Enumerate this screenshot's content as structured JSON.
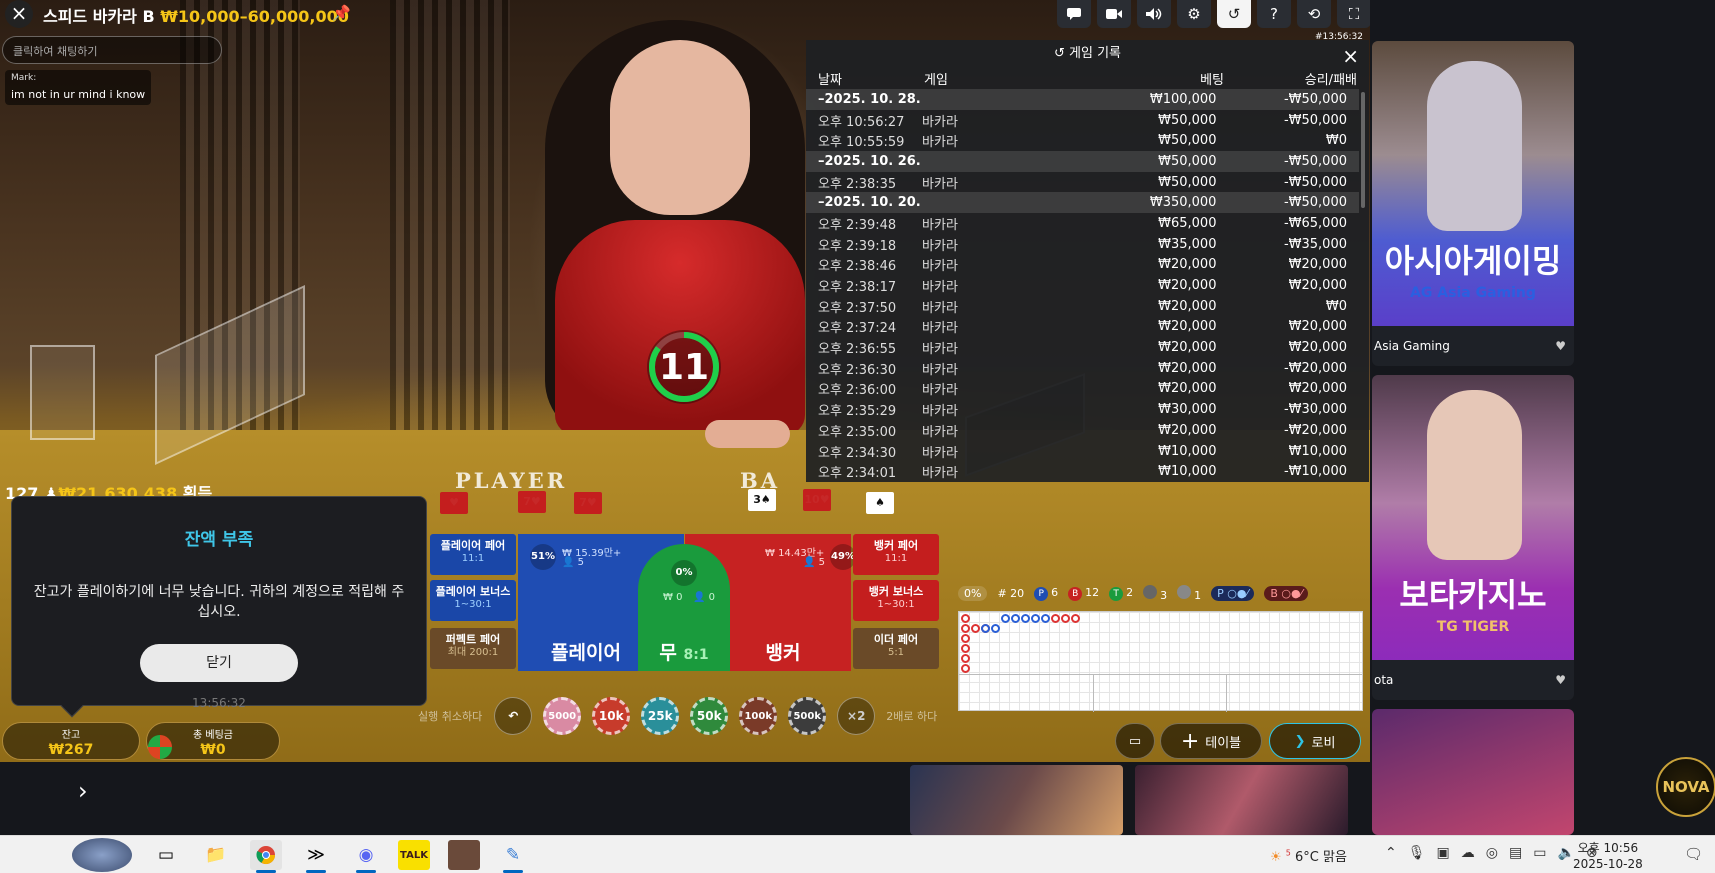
{
  "header": {
    "title": "스피드 바카라 B",
    "limit": "₩10,000–60,000,000",
    "chat_placeholder": "클릭하여 채팅하기",
    "chat_user": "Mark:",
    "chat_text": "im not in ur mind i know",
    "clock": "#13:56:32"
  },
  "toolbar": [
    "chat-icon",
    "video-icon",
    "volume-icon",
    "gear-icon",
    "history-icon",
    "help-icon",
    "refresh-icon",
    "fullscreen-icon"
  ],
  "timer": "11",
  "winnings": {
    "count": "127",
    "amount": "₩21,630,438",
    "label": "획득"
  },
  "felt": {
    "player": "PLAYER",
    "banker": "BA"
  },
  "history": {
    "title": "게임 기록",
    "columns": [
      "날짜",
      "게임",
      "베팅",
      "승리/패배"
    ],
    "rows": [
      {
        "date": "–2025. 10. 28.",
        "game": "",
        "bet": "₩100,000",
        "result": "-₩50,000",
        "sep": true
      },
      {
        "date": "오후 10:56:27",
        "game": "바카라",
        "bet": "₩50,000",
        "result": "-₩50,000"
      },
      {
        "date": "오후 10:55:59",
        "game": "바카라",
        "bet": "₩50,000",
        "result": "₩0"
      },
      {
        "date": "–2025. 10. 26.",
        "game": "",
        "bet": "₩50,000",
        "result": "-₩50,000",
        "sep": true
      },
      {
        "date": "오후 2:38:35",
        "game": "바카라",
        "bet": "₩50,000",
        "result": "-₩50,000"
      },
      {
        "date": "–2025. 10. 20.",
        "game": "",
        "bet": "₩350,000",
        "result": "-₩50,000",
        "sep": true
      },
      {
        "date": "오후 2:39:48",
        "game": "바카라",
        "bet": "₩65,000",
        "result": "-₩65,000"
      },
      {
        "date": "오후 2:39:18",
        "game": "바카라",
        "bet": "₩35,000",
        "result": "-₩35,000"
      },
      {
        "date": "오후 2:38:46",
        "game": "바카라",
        "bet": "₩20,000",
        "result": "₩20,000"
      },
      {
        "date": "오후 2:38:17",
        "game": "바카라",
        "bet": "₩20,000",
        "result": "₩20,000"
      },
      {
        "date": "오후 2:37:50",
        "game": "바카라",
        "bet": "₩20,000",
        "result": "₩0"
      },
      {
        "date": "오후 2:37:24",
        "game": "바카라",
        "bet": "₩20,000",
        "result": "₩20,000"
      },
      {
        "date": "오후 2:36:55",
        "game": "바카라",
        "bet": "₩20,000",
        "result": "₩20,000"
      },
      {
        "date": "오후 2:36:30",
        "game": "바카라",
        "bet": "₩20,000",
        "result": "-₩20,000"
      },
      {
        "date": "오후 2:36:00",
        "game": "바카라",
        "bet": "₩20,000",
        "result": "₩20,000"
      },
      {
        "date": "오후 2:35:29",
        "game": "바카라",
        "bet": "₩30,000",
        "result": "-₩30,000"
      },
      {
        "date": "오후 2:35:00",
        "game": "바카라",
        "bet": "₩20,000",
        "result": "-₩20,000"
      },
      {
        "date": "오후 2:34:30",
        "game": "바카라",
        "bet": "₩10,000",
        "result": "₩10,000"
      },
      {
        "date": "오후 2:34:01",
        "game": "바카라",
        "bet": "₩10,000",
        "result": "-₩10,000"
      }
    ]
  },
  "bets": {
    "player_pair": {
      "label": "플레이어 페어",
      "odds": "11:1"
    },
    "player_bonus": {
      "label": "플레이어 보너스",
      "odds": "1~30:1"
    },
    "perfect_pair": {
      "label": "퍼펙트 페어",
      "odds": "최대 200:1"
    },
    "banker_pair": {
      "label": "뱅커 페어",
      "odds": "11:1"
    },
    "banker_bonus": {
      "label": "뱅커 보너스",
      "odds": "1~30:1"
    },
    "either_pair": {
      "label": "이더 페어",
      "odds": "5:1"
    },
    "player": {
      "label": "플레이어",
      "pct": "51%",
      "amount": "₩ 15.39만+",
      "players": "5"
    },
    "tie": {
      "label": "무",
      "odds": "8:1",
      "pct": "0%",
      "amount": "₩ 0",
      "players": "0"
    },
    "banker": {
      "label": "뱅커",
      "pct": "49%",
      "amount": "₩ 14.43만+",
      "players": "5"
    }
  },
  "dialog": {
    "title": "잔액 부족",
    "body": "잔고가 플레이하기에 너무 낮습니다. 귀하의 계정으로 적립해 주십시오.",
    "button": "닫기",
    "time": "13:56:32"
  },
  "balance": {
    "label": "잔고",
    "value": "₩267"
  },
  "total_bet": {
    "label": "총 베팅금",
    "value": "₩0"
  },
  "chips": {
    "undo_label": "실행 취소하다",
    "values": [
      "5000",
      "10k",
      "25k",
      "50k",
      "100k",
      "500k"
    ],
    "double_symbol": "×2",
    "double_label": "2배로 하다"
  },
  "road_stats": {
    "pct": "0%",
    "rounds": "# 20",
    "p_label": "P",
    "p": "6",
    "b_label": "B",
    "b": "12",
    "t_label": "T",
    "t": "2",
    "pp": "3",
    "bp": "1"
  },
  "controls": {
    "table": "테이블",
    "lobby": "로비"
  },
  "promos": [
    {
      "caption": "Asia Gaming",
      "art_title": "아시아게이밍",
      "brand": "AG Asia Gaming"
    },
    {
      "caption": "ota",
      "art_title": "보타카지노",
      "brand": "TG TIGER"
    }
  ],
  "nova": "NOVA",
  "taskbar": {
    "weather_temp": "6°C",
    "weather_desc": "맑음",
    "weather_badge": "5",
    "time": "오후 10:56",
    "date": "2025-10-28"
  },
  "colors": {
    "accent_gold": "#f5c518",
    "player_blue": "#1f4db3",
    "banker_red": "#c62222",
    "tie_green": "#1a9b3d",
    "dialog_title": "#3fc6e8"
  }
}
